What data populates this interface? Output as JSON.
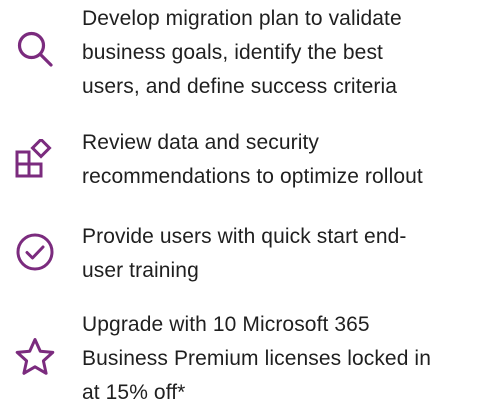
{
  "accent_color": "#7b2b7e",
  "items": [
    {
      "icon": "search-icon",
      "text": "Develop migration plan to validate\nbusiness goals, identify the best\nusers, and define success criteria"
    },
    {
      "icon": "apps-icon",
      "text": "Review data and security\nrecommendations to optimize rollout"
    },
    {
      "icon": "check-circle-icon",
      "text": "Provide users with quick start end-\nuser training"
    },
    {
      "icon": "star-icon",
      "text": "Upgrade with 10 Microsoft 365\nBusiness Premium licenses locked in\nat 15% off*"
    }
  ]
}
